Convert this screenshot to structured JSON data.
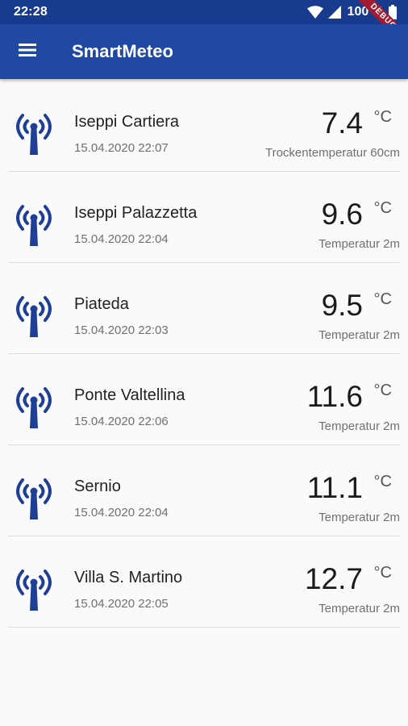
{
  "status_bar": {
    "time": "22:28",
    "battery": "100 %",
    "debug_label": "DEBUG"
  },
  "app_bar": {
    "title": "SmartMeteo",
    "menu_icon": "menu-icon"
  },
  "colors": {
    "primary": "#2149a3",
    "primary_dark": "#183a8f",
    "icon": "#1f3f96"
  },
  "stations": [
    {
      "name": "Iseppi Cartiera",
      "date": "15.04.2020 22:07",
      "temp": "7.4",
      "unit": "°C",
      "sensor": "Trockentemperatur 60cm",
      "icon": "antenna-icon"
    },
    {
      "name": "Iseppi Palazzetta",
      "date": "15.04.2020 22:04",
      "temp": "9.6",
      "unit": "°C",
      "sensor": "Temperatur 2m",
      "icon": "antenna-icon"
    },
    {
      "name": "Piateda",
      "date": "15.04.2020 22:03",
      "temp": "9.5",
      "unit": "°C",
      "sensor": "Temperatur 2m",
      "icon": "antenna-icon"
    },
    {
      "name": "Ponte Valtellina",
      "date": "15.04.2020 22:06",
      "temp": "11.6",
      "unit": "°C",
      "sensor": "Temperatur 2m",
      "icon": "antenna-icon"
    },
    {
      "name": "Sernio",
      "date": "15.04.2020 22:04",
      "temp": "11.1",
      "unit": "°C",
      "sensor": "Temperatur 2m",
      "icon": "antenna-icon"
    },
    {
      "name": "Villa S. Martino",
      "date": "15.04.2020 22:05",
      "temp": "12.7",
      "unit": "°C",
      "sensor": "Temperatur 2m",
      "icon": "antenna-icon"
    }
  ]
}
